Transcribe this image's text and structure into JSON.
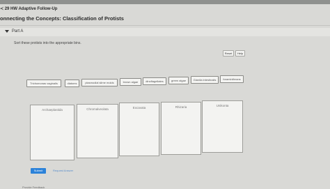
{
  "header": {
    "assignment": "≺ 29 HW Adaptive Follow-Up",
    "title": "onnecting the Concepts: Classification of Protists"
  },
  "part": {
    "label": "Part A"
  },
  "instructions": "Sort these protists into the appropriate bins.",
  "controls": {
    "reset": "Reset",
    "help": "Help"
  },
  "tiles": [
    "Trichomonas vaginalis",
    "diatoms",
    "plasmodial slime molds",
    "brown algae",
    "dinoflagellates",
    "green algae",
    "Giardia intestinalis",
    "foraminiferans"
  ],
  "bins": [
    "Archaeplastida",
    "Chromalveolata",
    "Excavata",
    "Rhizaria",
    "Unikonta"
  ],
  "footer": {
    "submit": "Submit",
    "request": "Request Answer",
    "feedback": "Provide Feedback"
  }
}
